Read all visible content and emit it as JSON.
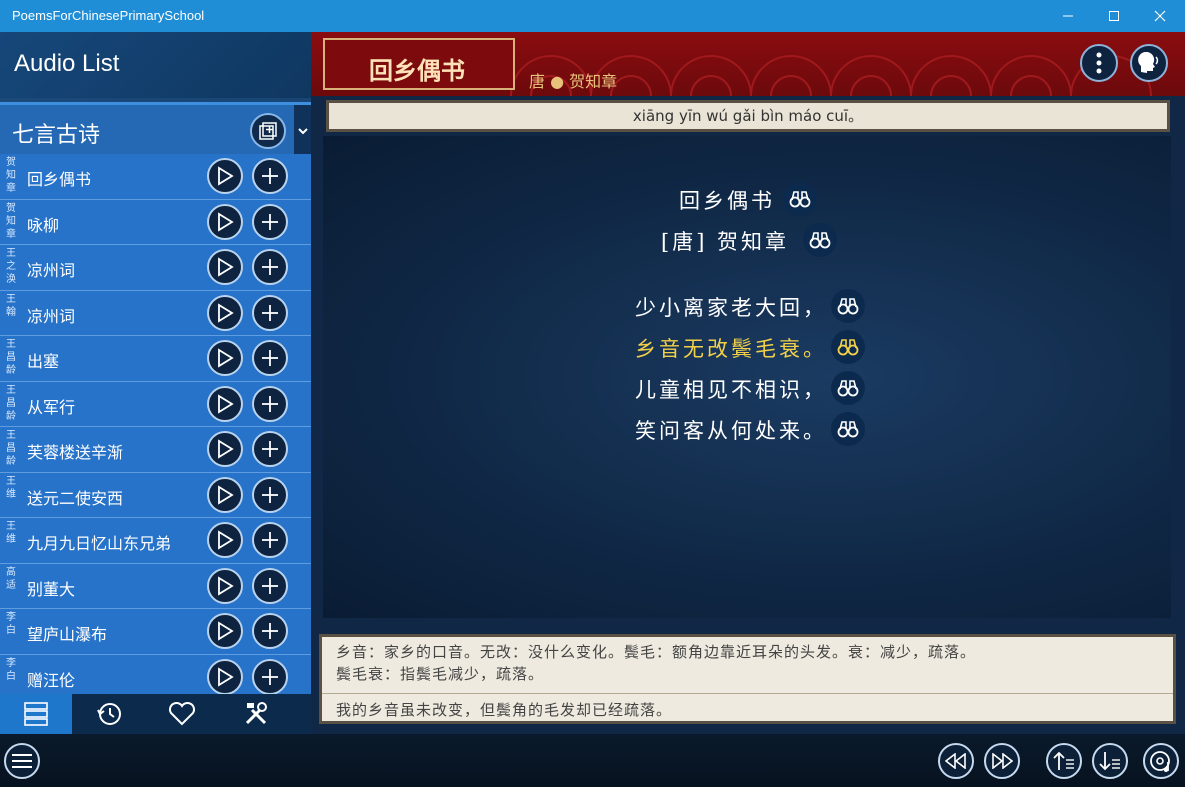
{
  "window": {
    "title": "PoemsForChinesePrimarySchool",
    "controls": {
      "minimize": "minimize-icon",
      "maximize": "maximize-icon",
      "close": "close-icon"
    }
  },
  "sidebar": {
    "header_title": "Audio List",
    "category": "七言古诗",
    "items": [
      {
        "author": "贺知章",
        "title": "回乡偶书"
      },
      {
        "author": "贺知章",
        "title": "咏柳"
      },
      {
        "author": "王之涣",
        "title": "凉州词"
      },
      {
        "author": "王翰",
        "title": "凉州词"
      },
      {
        "author": "王昌龄",
        "title": "出塞"
      },
      {
        "author": "王昌龄",
        "title": "从军行"
      },
      {
        "author": "王昌龄",
        "title": "芙蓉楼送辛渐"
      },
      {
        "author": "王维",
        "title": "送元二使安西"
      },
      {
        "author": "王维",
        "title": "九月九日忆山东兄弟"
      },
      {
        "author": "高适",
        "title": "别董大"
      },
      {
        "author": "李白",
        "title": "望庐山瀑布"
      },
      {
        "author": "李白",
        "title": "赠汪伦"
      }
    ],
    "tabs": [
      "list-icon",
      "history-icon",
      "heart-icon",
      "tools-icon"
    ]
  },
  "poem": {
    "title": "回乡偶书",
    "dynasty": "唐",
    "author": "贺知章",
    "pinyin": "xiāng yīn wú gǎi bìn máo cuī。",
    "display_title": "回乡偶书",
    "display_author": "[唐] 贺知章",
    "lines": [
      "少小离家老大回，",
      "乡音无改鬓毛衰。",
      "儿童相见不相识，",
      "笑问客从何处来。"
    ],
    "highlighted_line": 1,
    "note_lines": [
      "乡音：家乡的口音。无改：没什么变化。鬓毛：额角边靠近耳朵的头发。衰：减少，疏落。",
      "鬓毛衰：指鬓毛减少，疏落。"
    ],
    "translation": "我的乡音虽未改变，但鬓角的毛发却已经疏落。"
  },
  "colors": {
    "titlebar": "#1f8ed6",
    "list_bg": "#2673c9",
    "header_red": "#8a0c10",
    "highlight": "#f2d04a"
  }
}
